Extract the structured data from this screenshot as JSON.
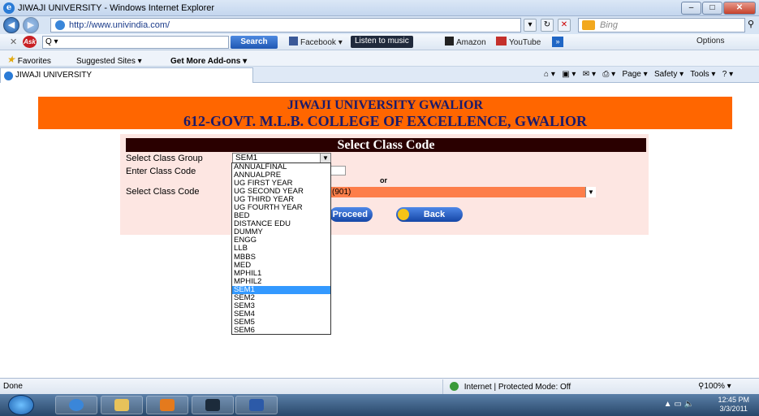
{
  "window": {
    "title": "JIWAJI UNIVERSITY - Windows Internet Explorer"
  },
  "address": {
    "url": "http://www.univindia.com/",
    "search_placeholder": "Bing"
  },
  "toolbar": {
    "search_label": "Search",
    "facebook": "Facebook ▾",
    "music": "Listen to music",
    "amazon": "Amazon",
    "youtube": "YouTube",
    "more": "»",
    "options": "Options"
  },
  "favorites": {
    "favorites_label": "Favorites",
    "suggested_sites": "Suggested Sites ▾",
    "add_ons": "Get More Add-ons ▾"
  },
  "tab": {
    "title": "JIWAJI UNIVERSITY"
  },
  "commandbar": {
    "items": [
      "Page ▾",
      "Safety ▾",
      "Tools ▾"
    ]
  },
  "header": {
    "line1": "JIWAJI UNIVERSITY GWALIOR",
    "line2": "612-GOVT. M.L.B. COLLEGE OF EXCELLENCE, GWALIOR"
  },
  "form": {
    "title": "Select Class Code",
    "group_label": "Select Class Group",
    "group_value": "SEM1",
    "code_label": "Enter Class Code",
    "or_label": "or",
    "select_code_label": "Select Class Code",
    "select_code_value": "(901)",
    "proceed_label": "Proceed",
    "back_label": "Back"
  },
  "dropdown": {
    "options": [
      "ANNUALFINAL",
      "ANNUALPRE",
      "UG FIRST YEAR",
      "UG SECOND YEAR",
      "UG THIRD YEAR",
      "UG FOURTH YEAR",
      "BED",
      "DISTANCE EDU",
      "DUMMY",
      "ENGG",
      "LLB",
      "MBBS",
      "MED",
      "MPHIL1",
      "MPHIL2",
      "SEM1",
      "SEM2",
      "SEM3",
      "SEM4",
      "SEM5",
      "SEM6"
    ],
    "selected": "SEM1"
  },
  "status": {
    "done": "Done",
    "zone": "Internet | Protected Mode: Off",
    "zoom": "100%"
  },
  "clock": {
    "time": "12:45 PM",
    "date": "3/3/2011"
  }
}
